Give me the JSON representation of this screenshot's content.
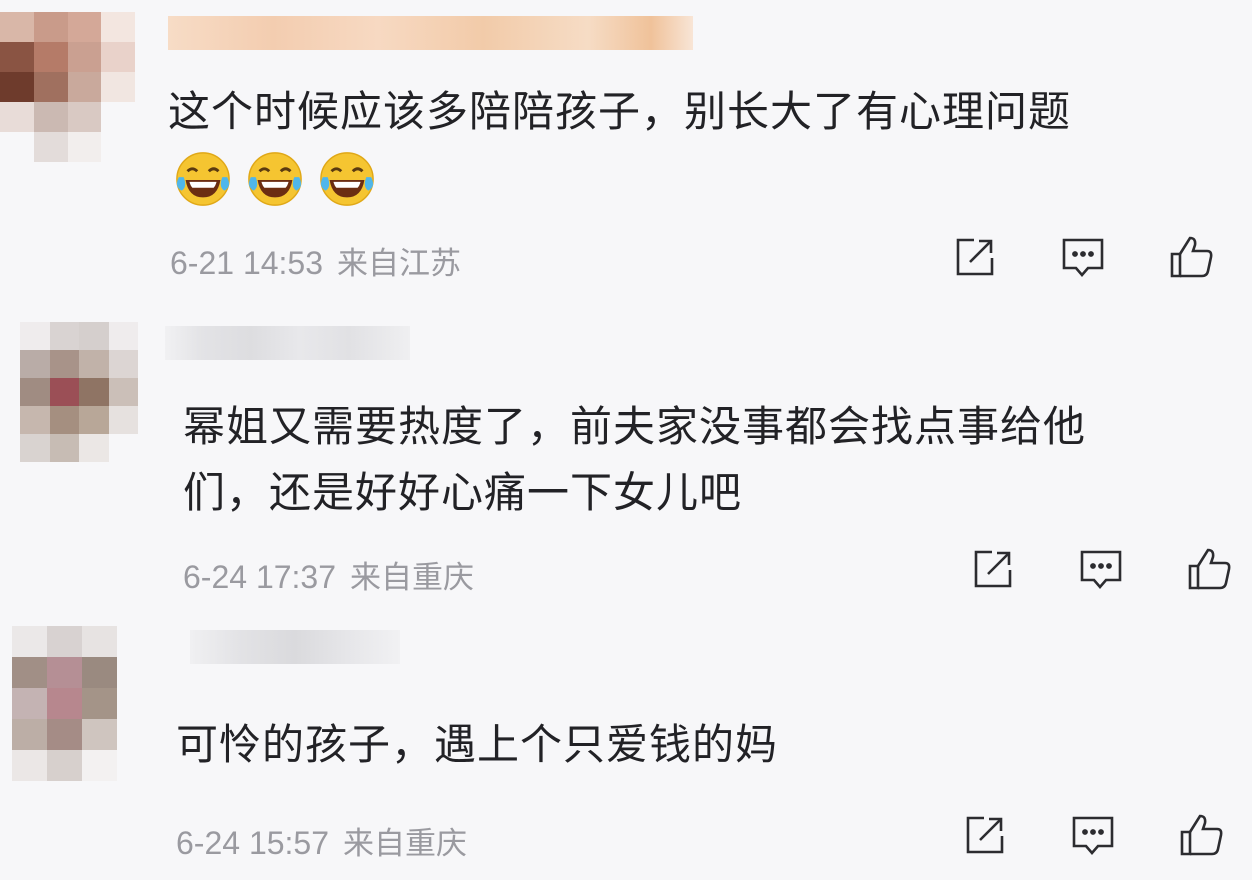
{
  "comments": [
    {
      "text_lines": [
        "这个时候应该多陪陪孩子，别长大了有心理问题"
      ],
      "emojis": [
        "laugh-cry-emoji",
        "laugh-cry-emoji",
        "laugh-cry-emoji"
      ],
      "date": "6-21 14:53",
      "location": "来自江苏"
    },
    {
      "text_lines": [
        "幂姐又需要热度了，前夫家没事都会找点事给他",
        "们，还是好好心痛一下女儿吧"
      ],
      "emojis": [],
      "date": "6-24 17:37",
      "location": "来自重庆"
    },
    {
      "text_lines": [
        "可怜的孩子，遇上个只爱钱的妈"
      ],
      "emojis": [],
      "date": "6-24 15:57",
      "location": "来自重庆"
    }
  ],
  "action_icons": [
    "share-icon",
    "reply-icon",
    "like-icon"
  ],
  "colors": {
    "background": "#f7f7f9",
    "text": "#222226",
    "meta": "#9a9aa0",
    "icon_stroke": "#2c2c30",
    "emoji_face": "#f5c531"
  }
}
